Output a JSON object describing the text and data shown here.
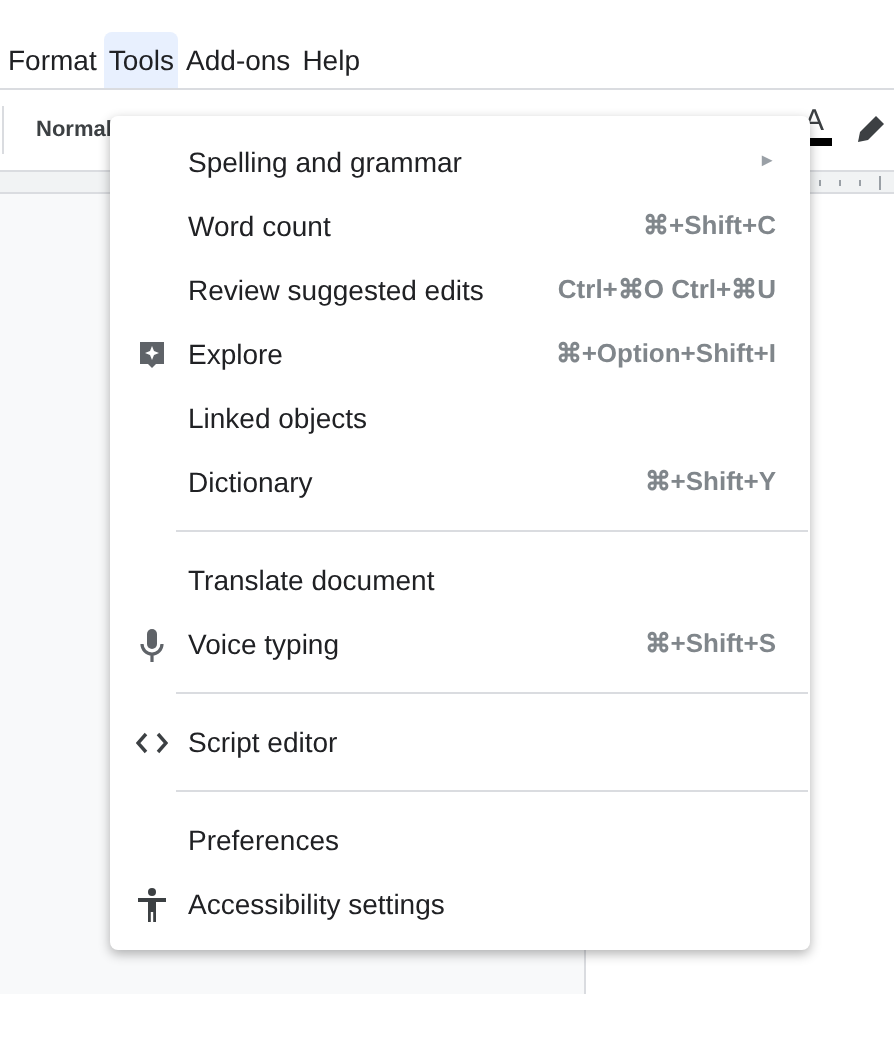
{
  "menu_bar": [
    {
      "label": "Format",
      "selected": false
    },
    {
      "label": "Tools",
      "selected": true
    },
    {
      "label": "Add-ons",
      "selected": false
    },
    {
      "label": "Help",
      "selected": false
    }
  ],
  "toolbar": {
    "style_select": "Normal",
    "text_color_glyph": "A"
  },
  "menu": {
    "groups": [
      {
        "items": [
          {
            "label": "Spelling and grammar",
            "submenu": true,
            "submenu_glyph": "►"
          },
          {
            "label": "Word count",
            "shortcut": "⌘+Shift+C"
          },
          {
            "label": "Review suggested edits",
            "shortcut": "Ctrl+⌘O Ctrl+⌘U"
          },
          {
            "label": "Explore",
            "shortcut": "⌘+Option+Shift+I",
            "kind": "explore"
          },
          {
            "label": "Linked objects"
          },
          {
            "label": "Dictionary",
            "shortcut": "⌘+Shift+Y"
          }
        ]
      },
      {
        "items": [
          {
            "label": "Translate document"
          },
          {
            "label": "Voice typing",
            "shortcut": "⌘+Shift+S",
            "kind": "mic"
          }
        ]
      },
      {
        "items": [
          {
            "label": "Script editor",
            "kind": "code"
          }
        ]
      },
      {
        "items": [
          {
            "label": "Preferences"
          },
          {
            "label": "Accessibility settings",
            "kind": "accessibility"
          }
        ]
      }
    ]
  }
}
